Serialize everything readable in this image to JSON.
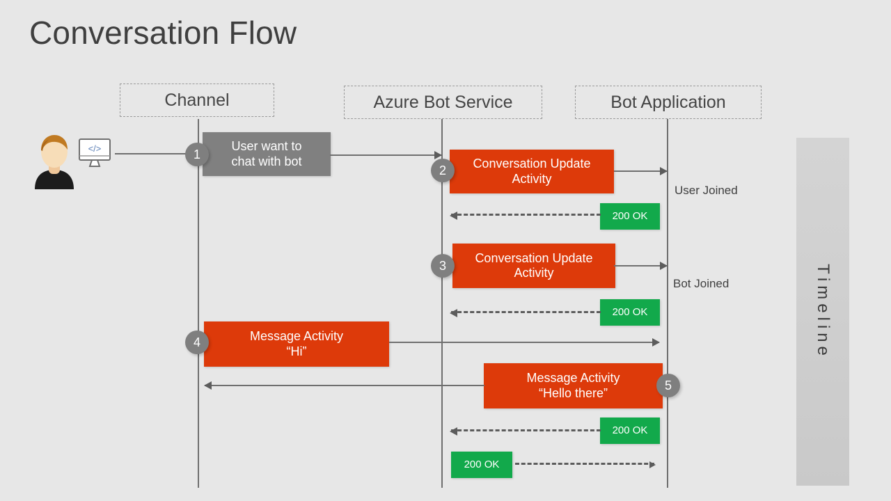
{
  "title": "Conversation Flow",
  "colors": {
    "background": "#e7e7e7",
    "activity": "#dd3a0a",
    "response": "#12a94b",
    "neutral": "#808080",
    "step": "#7f7f7f",
    "lifeline": "#6f6f6f",
    "timeline_bar": "#cfcfcf",
    "title_text": "#3f3f3f"
  },
  "lanes": [
    {
      "id": "channel",
      "label": "Channel"
    },
    {
      "id": "azure-bot-service",
      "label": "Azure Bot Service"
    },
    {
      "id": "bot-application",
      "label": "Bot Application"
    }
  ],
  "actor": {
    "icon": "user-avatar-icon",
    "device_icon": "monitor-code-icon",
    "device_glyph": "</>"
  },
  "steps": [
    {
      "number": "1"
    },
    {
      "number": "2"
    },
    {
      "number": "3"
    },
    {
      "number": "4"
    },
    {
      "number": "5"
    }
  ],
  "messages": [
    {
      "id": "user-want-chat",
      "line1": "User want to",
      "line2": "chat with bot",
      "kind": "neutral"
    },
    {
      "id": "conversation-update-1",
      "line1": "Conversation Update",
      "line2": "Activity",
      "kind": "activity"
    },
    {
      "id": "ok-1",
      "line1": "200 OK",
      "line2": "",
      "kind": "response"
    },
    {
      "id": "conversation-update-2",
      "line1": "Conversation Update",
      "line2": "Activity",
      "kind": "activity"
    },
    {
      "id": "ok-2",
      "line1": "200 OK",
      "line2": "",
      "kind": "response"
    },
    {
      "id": "message-hi",
      "line1": "Message Activity",
      "line2": "“Hi”",
      "kind": "activity"
    },
    {
      "id": "message-hello-there",
      "line1": "Message Activity",
      "line2": "“Hello there”",
      "kind": "activity"
    },
    {
      "id": "ok-3",
      "line1": "200 OK",
      "line2": "",
      "kind": "response"
    },
    {
      "id": "ok-4",
      "line1": "200 OK",
      "line2": "",
      "kind": "response"
    }
  ],
  "annotations": [
    {
      "id": "user-joined",
      "label": "User Joined"
    },
    {
      "id": "bot-joined",
      "label": "Bot Joined"
    }
  ],
  "timeline": {
    "label": "Timeline"
  }
}
